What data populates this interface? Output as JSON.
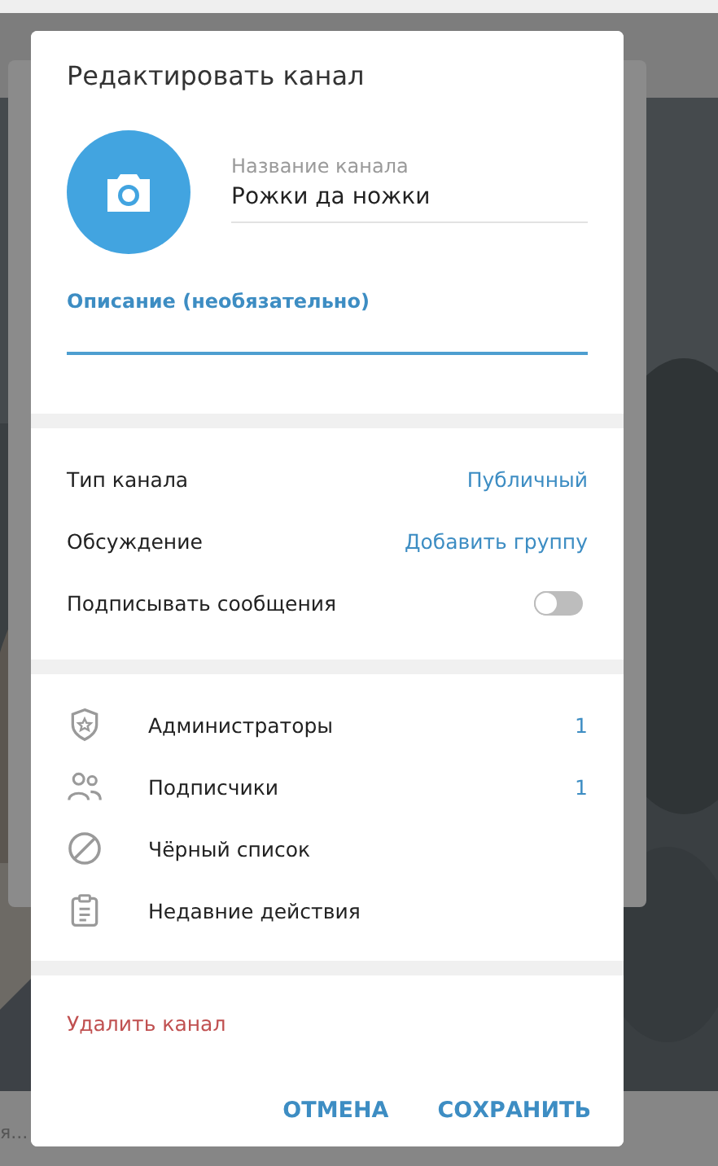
{
  "background": {
    "snippet": "я..."
  },
  "dialog": {
    "title": "Редактировать канал",
    "name_field": {
      "label": "Название канала",
      "value": "Рожки да ножки"
    },
    "description_field": {
      "placeholder": "Описание (необязательно)"
    },
    "settings": [
      {
        "kind": "link",
        "label": "Тип канала",
        "value": "Публичный"
      },
      {
        "kind": "link",
        "label": "Обсуждение",
        "value": "Добавить группу"
      },
      {
        "kind": "toggle",
        "label": "Подписывать сообщения",
        "on": false
      }
    ],
    "members": [
      {
        "kind": "shield",
        "label": "Администраторы",
        "count": "1"
      },
      {
        "kind": "people",
        "label": "Подписчики",
        "count": "1"
      },
      {
        "kind": "ban",
        "label": "Чёрный список"
      },
      {
        "kind": "clipboard",
        "label": "Недавние действия"
      }
    ],
    "delete_label": "Удалить канал",
    "buttons": [
      "ОТМЕНА",
      "СОХРАНИТЬ"
    ]
  }
}
